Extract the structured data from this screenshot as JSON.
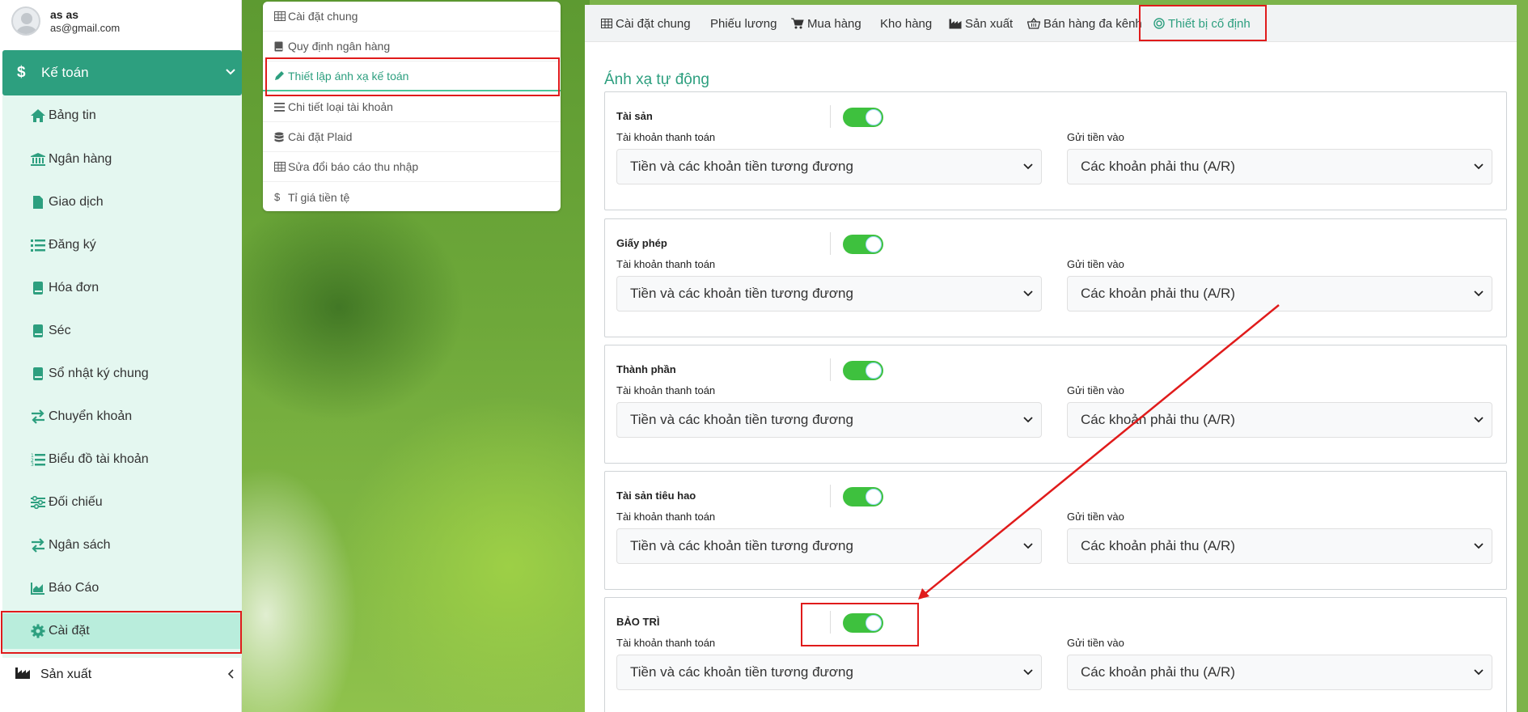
{
  "user": {
    "name": "as as",
    "email": "as@gmail.com"
  },
  "sidebar": {
    "group_label": "Kế toán",
    "items": [
      {
        "label": "Bảng tin",
        "icon": "home-icon"
      },
      {
        "label": "Ngân hàng",
        "icon": "bank-icon"
      },
      {
        "label": "Giao dịch",
        "icon": "file-icon"
      },
      {
        "label": "Đăng ký",
        "icon": "list-icon"
      },
      {
        "label": "Hóa đơn",
        "icon": "book-icon"
      },
      {
        "label": "Séc",
        "icon": "book-icon"
      },
      {
        "label": "Sổ nhật ký chung",
        "icon": "book-icon"
      },
      {
        "label": "Chuyển khoản",
        "icon": "exchange-icon"
      },
      {
        "label": "Biểu đồ tài khoản",
        "icon": "ordered-list-icon"
      },
      {
        "label": "Đối chiếu",
        "icon": "sliders-icon"
      },
      {
        "label": "Ngân sách",
        "icon": "exchange-icon"
      },
      {
        "label": "Báo Cáo",
        "icon": "area-chart-icon"
      },
      {
        "label": "Cài đặt",
        "icon": "gear-icon"
      }
    ],
    "bottom_label": "Sản xuất"
  },
  "settings_menu": [
    {
      "label": "Cài đặt chung",
      "icon": "table-icon"
    },
    {
      "label": "Quy định ngân hàng",
      "icon": "book-icon"
    },
    {
      "label": "Thiết lập ánh xạ kế toán",
      "icon": "pencil-icon"
    },
    {
      "label": "Chi tiết loại tài khoản",
      "icon": "list-icon"
    },
    {
      "label": "Cài đặt Plaid",
      "icon": "database-icon"
    },
    {
      "label": "Sửa đổi báo cáo thu nhập",
      "icon": "table-icon"
    },
    {
      "label": "Tỉ giá tiền tệ",
      "icon": "dollar-icon"
    }
  ],
  "tabs": [
    {
      "label": "Cài đặt chung",
      "icon": "table-icon"
    },
    {
      "label": "Phiếu lương",
      "icon": ""
    },
    {
      "label": "Mua hàng",
      "icon": "cart-icon"
    },
    {
      "label": "Kho hàng",
      "icon": ""
    },
    {
      "label": "Sản xuất",
      "icon": "factory-icon"
    },
    {
      "label": "Bán hàng đa kênh",
      "icon": "basket-icon"
    },
    {
      "label": "Thiết bị cố định",
      "icon": "target-icon"
    }
  ],
  "section_title": "Ánh xạ tự động",
  "labels": {
    "payment_account": "Tài khoản thanh toán",
    "deposit_to": "Gửi tiền vào"
  },
  "mappings": [
    {
      "name": "Tài sản",
      "enabled": true,
      "payment": "Tiền và các khoản tiền tương đương",
      "deposit": "Các khoản phải thu (A/R)"
    },
    {
      "name": "Giấy phép",
      "enabled": true,
      "payment": "Tiền và các khoản tiền tương đương",
      "deposit": "Các khoản phải thu (A/R)"
    },
    {
      "name": "Thành phần",
      "enabled": true,
      "payment": "Tiền và các khoản tiền tương đương",
      "deposit": "Các khoản phải thu (A/R)"
    },
    {
      "name": "Tài sản tiêu hao",
      "enabled": true,
      "payment": "Tiền và các khoản tiền tương đương",
      "deposit": "Các khoản phải thu (A/R)"
    },
    {
      "name": "BẢO TRÌ",
      "enabled": true,
      "payment": "Tiền và các khoản tiền tương đương",
      "deposit": "Các khoản phải thu (A/R)"
    }
  ],
  "colors": {
    "accent": "#2d9f7f",
    "toggle_on": "#3ec13e",
    "annotation": "#e01b1b"
  }
}
